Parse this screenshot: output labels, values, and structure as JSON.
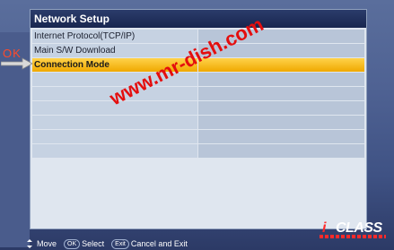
{
  "window": {
    "title": "Network Setup"
  },
  "menu": {
    "items": [
      {
        "label": "Internet Protocol(TCP/IP)",
        "value": ""
      },
      {
        "label": "Main S/W Download",
        "value": ""
      },
      {
        "label": "Connection Mode",
        "value": ""
      },
      {
        "label": "",
        "value": ""
      },
      {
        "label": "",
        "value": ""
      },
      {
        "label": "",
        "value": ""
      },
      {
        "label": "",
        "value": ""
      },
      {
        "label": "",
        "value": ""
      },
      {
        "label": "",
        "value": ""
      }
    ],
    "selected_index": 2
  },
  "overlay": {
    "ok_label": "OK",
    "watermark": "www.mr-dish.com"
  },
  "footer": {
    "move_label": "Move",
    "select_key": "OK",
    "select_label": "Select",
    "exit_key": "Exit",
    "exit_label": "Cancel and Exit"
  },
  "brand": {
    "logo_i": "i",
    "logo_text": "CLASS"
  },
  "colors": {
    "selected": "#f0a800",
    "title_bar": "#18264f",
    "watermark": "#e40e0e"
  }
}
